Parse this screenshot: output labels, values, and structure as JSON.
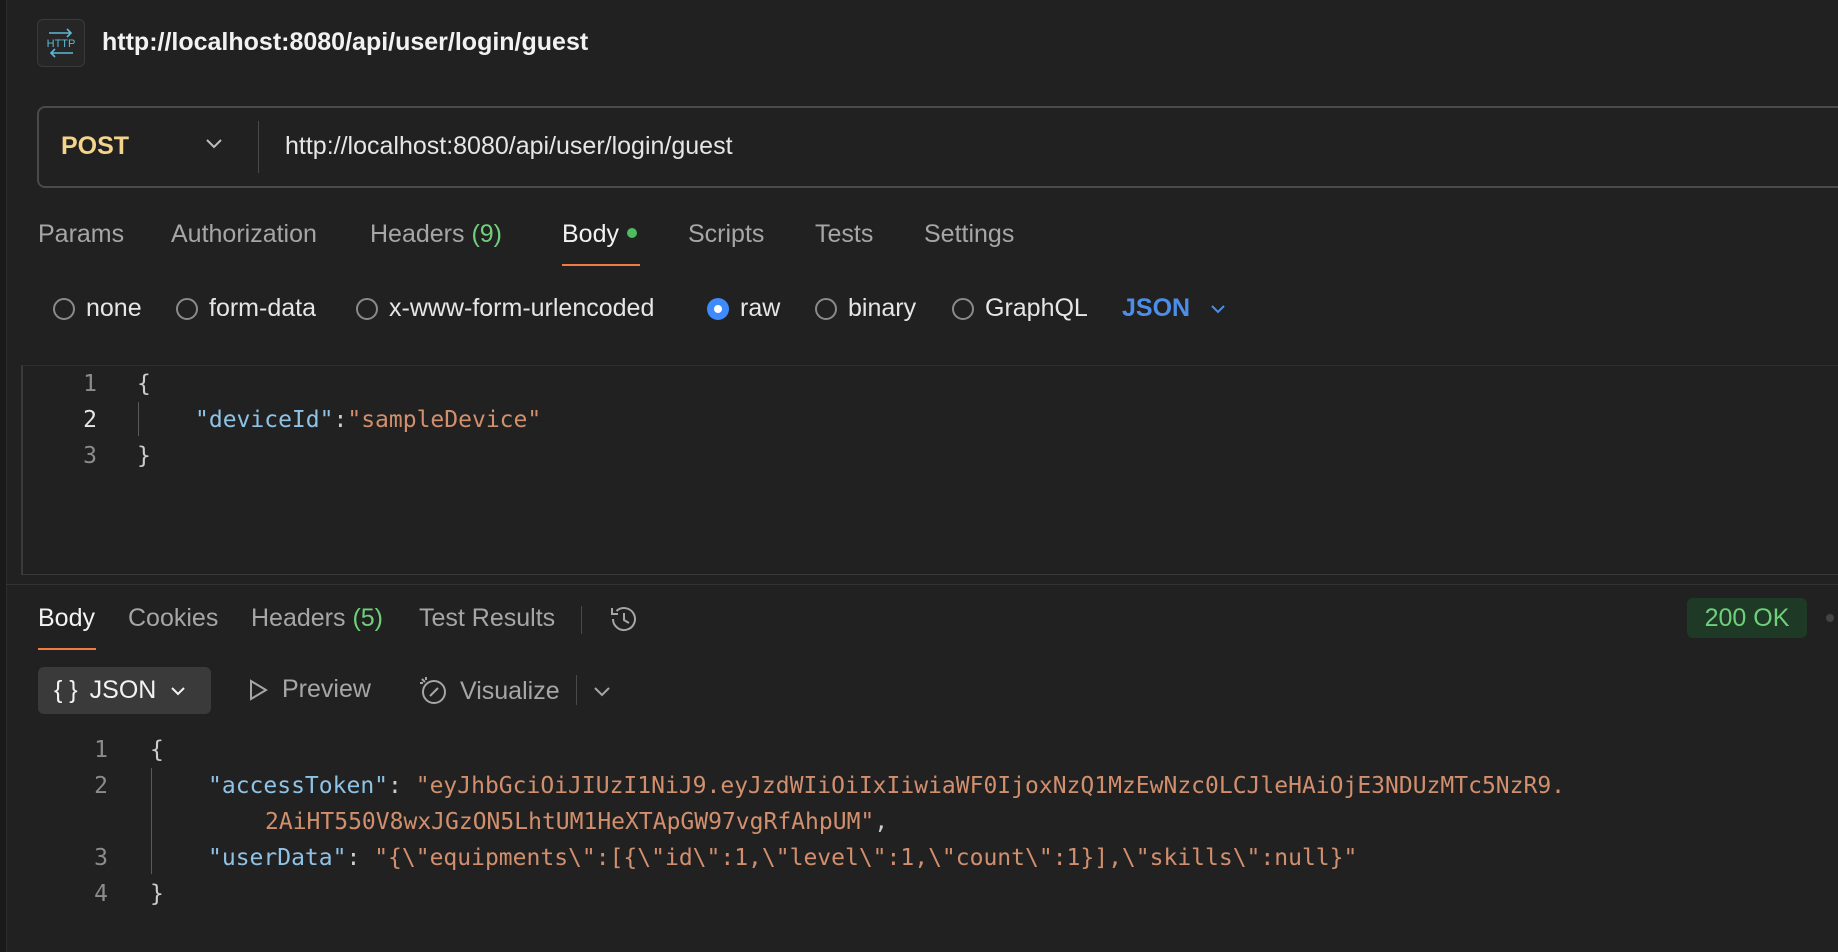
{
  "request": {
    "title": "http://localhost:8080/api/user/login/guest",
    "method": "POST",
    "url": "http://localhost:8080/api/user/login/guest",
    "tabs": [
      {
        "label": "Params"
      },
      {
        "label": "Authorization"
      },
      {
        "label": "Headers",
        "count": "(9)"
      },
      {
        "label": "Body",
        "active": true,
        "modified": true
      },
      {
        "label": "Scripts"
      },
      {
        "label": "Tests"
      },
      {
        "label": "Settings"
      }
    ],
    "body_types": [
      {
        "label": "none",
        "selected": false
      },
      {
        "label": "form-data",
        "selected": false
      },
      {
        "label": "x-www-form-urlencoded",
        "selected": false
      },
      {
        "label": "raw",
        "selected": true
      },
      {
        "label": "binary",
        "selected": false
      },
      {
        "label": "GraphQL",
        "selected": false
      }
    ],
    "raw_format": "JSON",
    "editor": {
      "line_numbers": [
        "1",
        "2",
        "3"
      ],
      "open_brace": "{",
      "close_brace": "}",
      "key": "\"deviceId\"",
      "colon": ":",
      "value": "\"sampleDevice\""
    }
  },
  "response": {
    "tabs": [
      {
        "label": "Body",
        "active": true
      },
      {
        "label": "Cookies"
      },
      {
        "label": "Headers",
        "count": "(5)"
      },
      {
        "label": "Test Results"
      }
    ],
    "status": "200 OK",
    "toolbar": {
      "format_icon": "{ }",
      "format_label": "JSON",
      "preview_label": "Preview",
      "visualize_label": "Visualize"
    },
    "body": {
      "line_numbers": [
        "1",
        "2",
        "3",
        "4"
      ],
      "open_brace": "{",
      "close_brace": "}",
      "access_token_key": "\"accessToken\"",
      "access_token_value_line1": "\"eyJhbGciOiJIUzI1NiJ9.eyJzdWIiOiIxIiwiaWF0IjoxNzQ1MzEwNzc0LCJleHAiOjE3NDUzMTc5NzR9.",
      "access_token_value_line2": "2AiHT550V8wxJGzON5LhtUM1HeXTApGW97vgRfAhpUM\"",
      "user_data_key": "\"userData\"",
      "user_data_value": "\"{\\\"equipments\\\":[{\\\"id\\\":1,\\\"level\\\":1,\\\"count\\\":1}],\\\"skills\\\":null}\"",
      "colon_sep": ": ",
      "comma": ","
    }
  },
  "colors": {
    "accent": "#f07b3f",
    "method": "#f4d38a",
    "status_ok": "#6fcf7a",
    "json_blue": "#4c8ee8",
    "radio_selected": "#3d8bfd"
  },
  "icons": {
    "app": "http-icon",
    "method_dropdown": "chevron-down-icon",
    "format_dropdown": "chevron-down-icon",
    "history": "history-icon",
    "preview": "play-icon",
    "visualize": "visualize-icon"
  }
}
